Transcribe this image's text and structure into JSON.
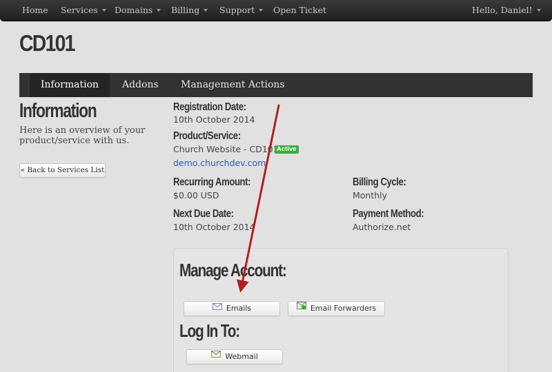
{
  "nav": {
    "items": [
      {
        "label": "Home",
        "dropdown": false
      },
      {
        "label": "Services",
        "dropdown": true
      },
      {
        "label": "Domains",
        "dropdown": true
      },
      {
        "label": "Billing",
        "dropdown": true
      },
      {
        "label": "Support",
        "dropdown": true
      },
      {
        "label": "Open Ticket",
        "dropdown": false
      }
    ],
    "user_label": "Hello, Daniel!"
  },
  "page": {
    "title": "CD101"
  },
  "tabs": [
    {
      "label": "Information",
      "active": true
    },
    {
      "label": "Addons",
      "active": false
    },
    {
      "label": "Management Actions",
      "active": false
    }
  ],
  "sidebar": {
    "heading": "Information",
    "description": "Here is an overview of your product/service with us.",
    "back_button": "« Back to Services List"
  },
  "details": {
    "registration_date": {
      "label": "Registration Date:",
      "value": "10th October 2014"
    },
    "product_service": {
      "label": "Product/Service:",
      "value": "Church Website - CD101",
      "status": "Active",
      "domain": "demo.churchdev.com"
    },
    "recurring_amount": {
      "label": "Recurring Amount:",
      "value": "$0.00 USD"
    },
    "billing_cycle": {
      "label": "Billing Cycle:",
      "value": "Monthly"
    },
    "next_due_date": {
      "label": "Next Due Date:",
      "value": "10th October 2014"
    },
    "payment_method": {
      "label": "Payment Method:",
      "value": "Authorize.net"
    }
  },
  "manage": {
    "heading": "Manage Account:",
    "buttons": [
      {
        "label": "Emails",
        "icon": "envelope-icon"
      },
      {
        "label": "Email Forwarders",
        "icon": "email-forwarders-icon"
      }
    ]
  },
  "login": {
    "heading": "Log In To:",
    "buttons": [
      {
        "label": "Webmail",
        "icon": "webmail-icon"
      }
    ]
  },
  "colors": {
    "nav_bg": "#262626",
    "tab_bg": "#323232",
    "status_active": "#3cac3c",
    "link": "#2a5db0",
    "arrow": "#b01e1e"
  }
}
